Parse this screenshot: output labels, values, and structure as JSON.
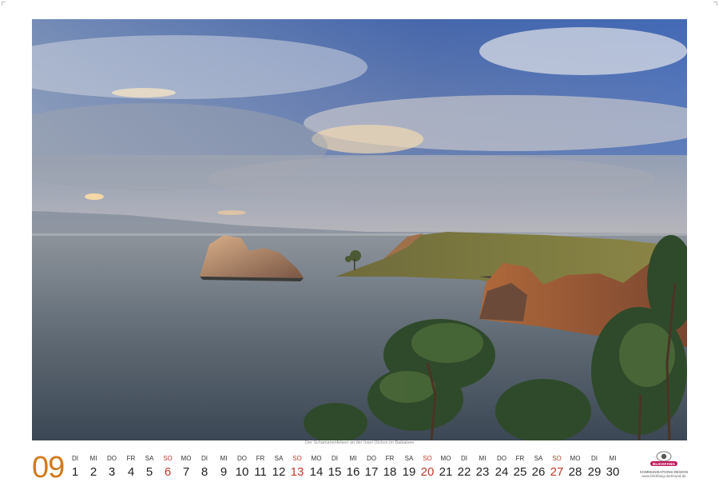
{
  "photo": {
    "caption": "Der Schamanenfelsen an der Insel Olchon im Baikalsee"
  },
  "calendar": {
    "month_number": "09",
    "accent_color": "#d27a1c",
    "sunday_color": "#c0392b",
    "days": [
      {
        "name": "DI",
        "num": "1"
      },
      {
        "name": "MI",
        "num": "2"
      },
      {
        "name": "DO",
        "num": "3"
      },
      {
        "name": "FR",
        "num": "4"
      },
      {
        "name": "SA",
        "num": "5"
      },
      {
        "name": "SO",
        "num": "6"
      },
      {
        "name": "MO",
        "num": "7"
      },
      {
        "name": "DI",
        "num": "8"
      },
      {
        "name": "MI",
        "num": "9"
      },
      {
        "name": "DO",
        "num": "10"
      },
      {
        "name": "FR",
        "num": "11"
      },
      {
        "name": "SA",
        "num": "12"
      },
      {
        "name": "SO",
        "num": "13"
      },
      {
        "name": "MO",
        "num": "14"
      },
      {
        "name": "DI",
        "num": "15"
      },
      {
        "name": "MI",
        "num": "16"
      },
      {
        "name": "DO",
        "num": "17"
      },
      {
        "name": "FR",
        "num": "18"
      },
      {
        "name": "SA",
        "num": "19"
      },
      {
        "name": "SO",
        "num": "20"
      },
      {
        "name": "MO",
        "num": "21"
      },
      {
        "name": "DI",
        "num": "22"
      },
      {
        "name": "MI",
        "num": "23"
      },
      {
        "name": "DO",
        "num": "24"
      },
      {
        "name": "FR",
        "num": "25"
      },
      {
        "name": "SA",
        "num": "26"
      },
      {
        "name": "SO",
        "num": "27"
      },
      {
        "name": "MO",
        "num": "28"
      },
      {
        "name": "DI",
        "num": "29"
      },
      {
        "name": "MI",
        "num": "30"
      }
    ]
  },
  "brand": {
    "logo_text": "BLICKFANG",
    "line1": "KOMMUNIKATIONS-DESIGN",
    "line2": "www.blickfang-dortmund.de"
  }
}
